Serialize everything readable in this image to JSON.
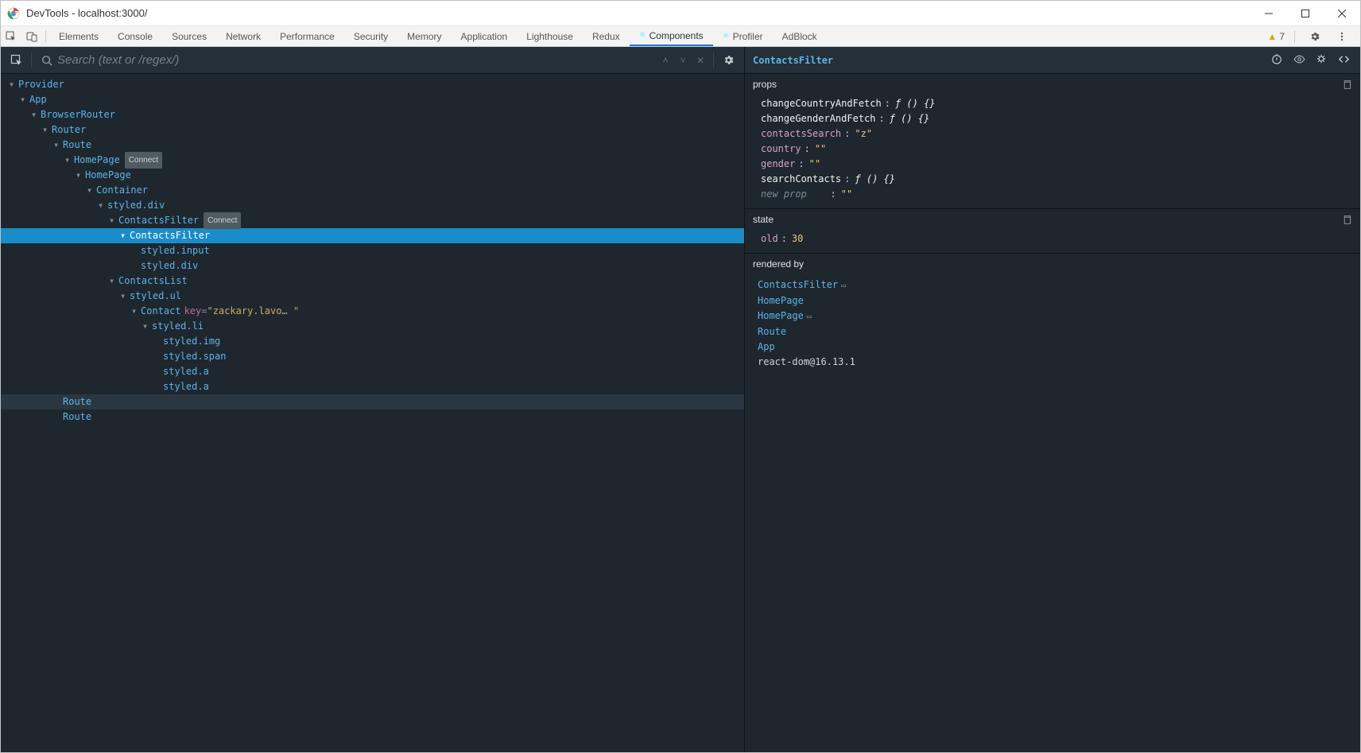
{
  "window": {
    "title": "DevTools - localhost:3000/",
    "warning_count": "7"
  },
  "tabs": [
    {
      "label": "Elements"
    },
    {
      "label": "Console"
    },
    {
      "label": "Sources"
    },
    {
      "label": "Network"
    },
    {
      "label": "Performance"
    },
    {
      "label": "Security"
    },
    {
      "label": "Memory"
    },
    {
      "label": "Application"
    },
    {
      "label": "Lighthouse"
    },
    {
      "label": "Redux"
    },
    {
      "label": "Components",
      "active": true,
      "react": true
    },
    {
      "label": "Profiler",
      "react": true
    },
    {
      "label": "AdBlock"
    }
  ],
  "search": {
    "placeholder": "Search (text or /regex/)"
  },
  "tree": [
    {
      "indent": 0,
      "name": "Provider",
      "arrow": true
    },
    {
      "indent": 1,
      "name": "App",
      "arrow": true
    },
    {
      "indent": 2,
      "name": "BrowserRouter",
      "arrow": true
    },
    {
      "indent": 3,
      "name": "Router",
      "arrow": true
    },
    {
      "indent": 4,
      "name": "Route",
      "arrow": true
    },
    {
      "indent": 5,
      "name": "HomePage",
      "arrow": true,
      "connect": true
    },
    {
      "indent": 6,
      "name": "HomePage",
      "arrow": true
    },
    {
      "indent": 7,
      "name": "Container",
      "arrow": true
    },
    {
      "indent": 8,
      "name": "styled.div",
      "arrow": true
    },
    {
      "indent": 9,
      "name": "ContactsFilter",
      "arrow": true,
      "connect": true
    },
    {
      "indent": 10,
      "name": "ContactsFilter",
      "arrow": true,
      "selected": true
    },
    {
      "indent": 11,
      "name": "styled.input"
    },
    {
      "indent": 11,
      "name": "styled.div"
    },
    {
      "indent": 9,
      "name": "ContactsList",
      "arrow": true
    },
    {
      "indent": 10,
      "name": "styled.ul",
      "arrow": true
    },
    {
      "indent": 11,
      "name": "Contact",
      "arrow": true,
      "key": "zackary.lavo… "
    },
    {
      "indent": 12,
      "name": "styled.li",
      "arrow": true
    },
    {
      "indent": 13,
      "name": "styled.img"
    },
    {
      "indent": 13,
      "name": "styled.span"
    },
    {
      "indent": 13,
      "name": "styled.a"
    },
    {
      "indent": 13,
      "name": "styled.a"
    },
    {
      "indent": 4,
      "name": "Route",
      "hover": true
    },
    {
      "indent": 4,
      "name": "Route"
    }
  ],
  "detail": {
    "title": "ContactsFilter",
    "props_label": "props",
    "state_label": "state",
    "rendered_label": "rendered by",
    "props": [
      {
        "key": "changeCountryAndFetch",
        "type": "fn",
        "value": "ƒ () {}"
      },
      {
        "key": "changeGenderAndFetch",
        "type": "fn",
        "value": "ƒ () {}"
      },
      {
        "key": "contactsSearch",
        "type": "str",
        "value": "\"z\""
      },
      {
        "key": "country",
        "type": "str",
        "value": "\"\""
      },
      {
        "key": "gender",
        "type": "str",
        "value": "\"\""
      },
      {
        "key": "searchContacts",
        "type": "fn",
        "value": "ƒ () {}"
      }
    ],
    "new_prop_label": "new prop",
    "new_prop_value": "\"\"",
    "state": [
      {
        "key": "old",
        "type": "num",
        "value": "30"
      }
    ],
    "rendered_by": [
      {
        "label": "ContactsFilter",
        "badge": true
      },
      {
        "label": "HomePage"
      },
      {
        "label": "HomePage",
        "badge": true
      },
      {
        "label": "Route"
      },
      {
        "label": "App"
      }
    ],
    "react_line": {
      "pkg": "react-dom",
      "ver": "16.13.1",
      "at": "@"
    }
  }
}
